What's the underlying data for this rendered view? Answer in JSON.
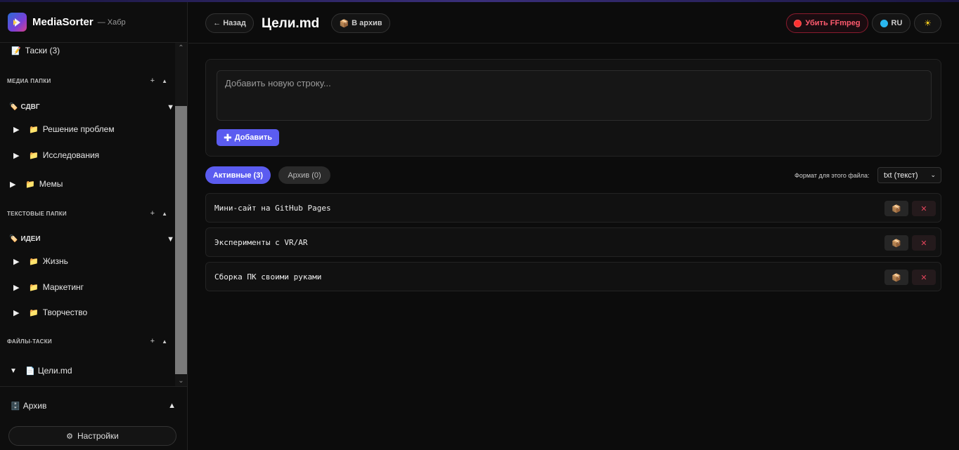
{
  "app": {
    "name": "MediaSorter",
    "subtitle": "— Хабр"
  },
  "sidebar": {
    "tasks_link": "Таски (3)",
    "media_section": {
      "title": "МЕДИА ПАПКИ",
      "add": "+",
      "collapse": "▲"
    },
    "media_group": {
      "label": "СДВГ",
      "toggle": "▼"
    },
    "media_folders": [
      "Решение проблем",
      "Исследования",
      "Мемы"
    ],
    "text_section": {
      "title": "ТЕКСТОВЫЕ ПАПКИ",
      "add": "+",
      "collapse": "▲"
    },
    "text_group": {
      "label": "ИДЕИ",
      "toggle": "▼"
    },
    "text_folders": [
      "Жизнь",
      "Маркетинг",
      "Творчество"
    ],
    "files_section": {
      "title": "ФАЙЛЫ-ТАСКИ",
      "add": "+",
      "collapse": "▲"
    },
    "files": [
      "Цели.md"
    ],
    "archive": {
      "label": "Архив",
      "toggle": "▲"
    },
    "settings_label": "Настройки"
  },
  "header": {
    "back_label": "← Назад",
    "title": "Цели.md",
    "archive_label": "В архив",
    "kill_label": "Убить FFmpeg",
    "lang_label": "RU",
    "theme_icon": "sun-icon"
  },
  "editor": {
    "placeholder": "Добавить новую строку...",
    "add_label": "Добавить"
  },
  "tabs": {
    "active": "Активные (3)",
    "archive": "Архив (0)"
  },
  "format": {
    "label": "Формат для этого файла:",
    "value": "txt (текст)"
  },
  "items": [
    {
      "text": "Мини-сайт на GitHub Pages"
    },
    {
      "text": "Эксперименты с VR/AR"
    },
    {
      "text": "Сборка ПК своими руками"
    }
  ],
  "colors": {
    "accent": "#5b5cf0",
    "danger": "#e0435a",
    "background": "#0c0c0c"
  }
}
